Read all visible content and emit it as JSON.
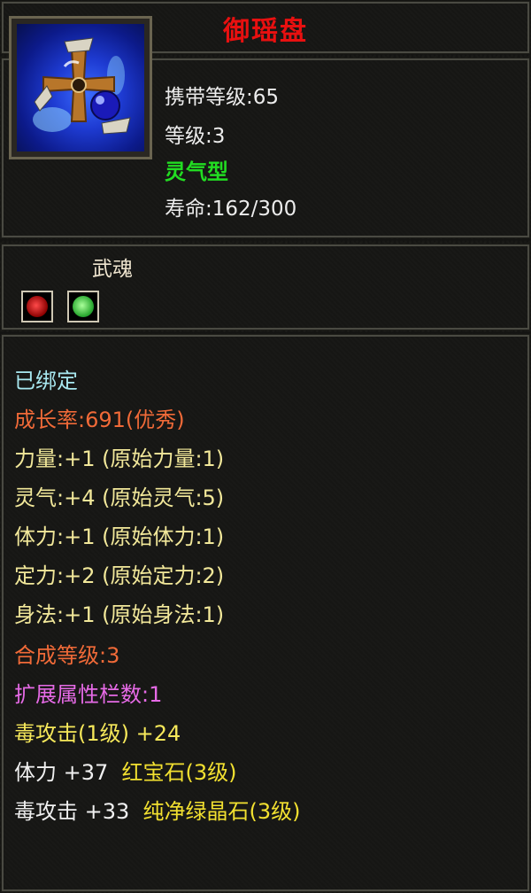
{
  "item": {
    "name": "御瑶盘",
    "icon": "spinning-disc-weapon-icon",
    "carry_level": "携带等级:65",
    "level": "等级:3",
    "type": "灵气型",
    "life": "寿命:162/300"
  },
  "soul": {
    "label": "武魂",
    "gems": [
      {
        "icon": "red-soul-gem-icon",
        "color": "#c81818"
      },
      {
        "icon": "green-soul-gem-icon",
        "color": "#30b040"
      }
    ]
  },
  "stats": {
    "bound": "已绑定",
    "growth": "成长率:691(优秀)",
    "strength": "力量:+1 (原始力量:1)",
    "aura": "灵气:+4 (原始灵气:5)",
    "vitality": "体力:+1 (原始体力:1)",
    "focus": "定力:+2 (原始定力:2)",
    "agility": "身法:+1 (原始身法:1)",
    "synth_level": "合成等级:3",
    "ext_slots": "扩展属性栏数:1",
    "poison_attack": "毒攻击(1级) +24",
    "gem1": {
      "stat": "体力 +37",
      "gem": "红宝石(3级)"
    },
    "gem2": {
      "stat": "毒攻击 +33",
      "gem": "纯净绿晶石(3级)"
    }
  },
  "colors": {
    "title": "#e81010",
    "type": "#22dd22",
    "bound": "#a8e8f0",
    "growth": "#f06a38",
    "attributes": "#f2e89a",
    "ext_slots": "#e66ae6",
    "gem_name": "#f2e030"
  }
}
